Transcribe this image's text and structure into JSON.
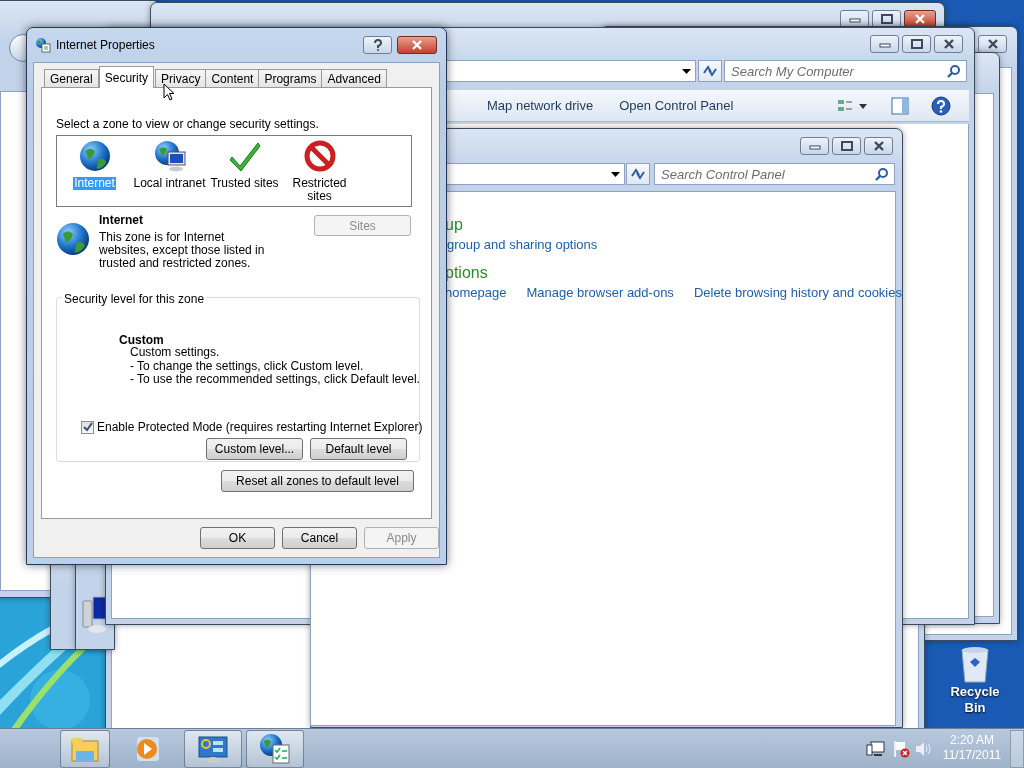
{
  "dialog": {
    "title": "Internet Properties",
    "tabs": [
      {
        "label": "General",
        "selected": false
      },
      {
        "label": "Security",
        "selected": true
      },
      {
        "label": "Privacy",
        "selected": false
      },
      {
        "label": "Content",
        "selected": false
      },
      {
        "label": "Programs",
        "selected": false
      },
      {
        "label": "Advanced",
        "selected": false
      }
    ],
    "zone_prompt": "Select a zone to view or change security settings.",
    "zones": [
      {
        "label": "Internet",
        "kind": "globe",
        "selected": true
      },
      {
        "label": "Local intranet",
        "kind": "intranet",
        "selected": false
      },
      {
        "label": "Trusted sites",
        "kind": "check",
        "selected": false
      },
      {
        "label": "Restricted sites",
        "kind": "blocked",
        "selected": false
      }
    ],
    "zone_name": "Internet",
    "zone_description": "This zone is for Internet websites, except those listed in trusted and restricted zones.",
    "sites_button": {
      "label": "Sites",
      "disabled": true
    },
    "level_group": "Security level for this zone",
    "level_name": "Custom",
    "level_lines": [
      "Custom settings.",
      "- To change the settings, click Custom level.",
      "- To use the recommended settings, click Default level."
    ],
    "protected_mode": {
      "label": "Enable Protected Mode (requires restarting Internet Explorer)",
      "checked": true
    },
    "level_buttons": [
      "Custom level...",
      "Default level"
    ],
    "reset_button": "Reset all zones to default level",
    "buttons": [
      {
        "label": "OK",
        "disabled": false
      },
      {
        "label": "Cancel",
        "disabled": false
      },
      {
        "label": "Apply",
        "disabled": true
      }
    ]
  },
  "my_computer_window": {
    "search_placeholder": "Search My Computer",
    "toolbar": [
      "Map network drive",
      "Open Control Panel"
    ]
  },
  "control_panel_window": {
    "search_placeholder": "Search Control Panel",
    "sections": [
      {
        "heading": "up",
        "links": [
          "group and sharing options"
        ]
      },
      {
        "heading": "ptions",
        "links": [
          "homepage",
          "Manage browser add-ons",
          "Delete browsing history and cookies"
        ]
      }
    ]
  },
  "desktop_icons": [
    {
      "label": "Recycle Bin"
    }
  ],
  "taskbar": {
    "buttons": [
      {
        "kind": "explorer",
        "open": true
      },
      {
        "kind": "media",
        "open": false
      },
      {
        "kind": "control_panel",
        "open": true
      },
      {
        "kind": "internet_options",
        "open": true
      }
    ],
    "clock": {
      "time": "2:20 AM",
      "date": "11/17/2011"
    }
  }
}
